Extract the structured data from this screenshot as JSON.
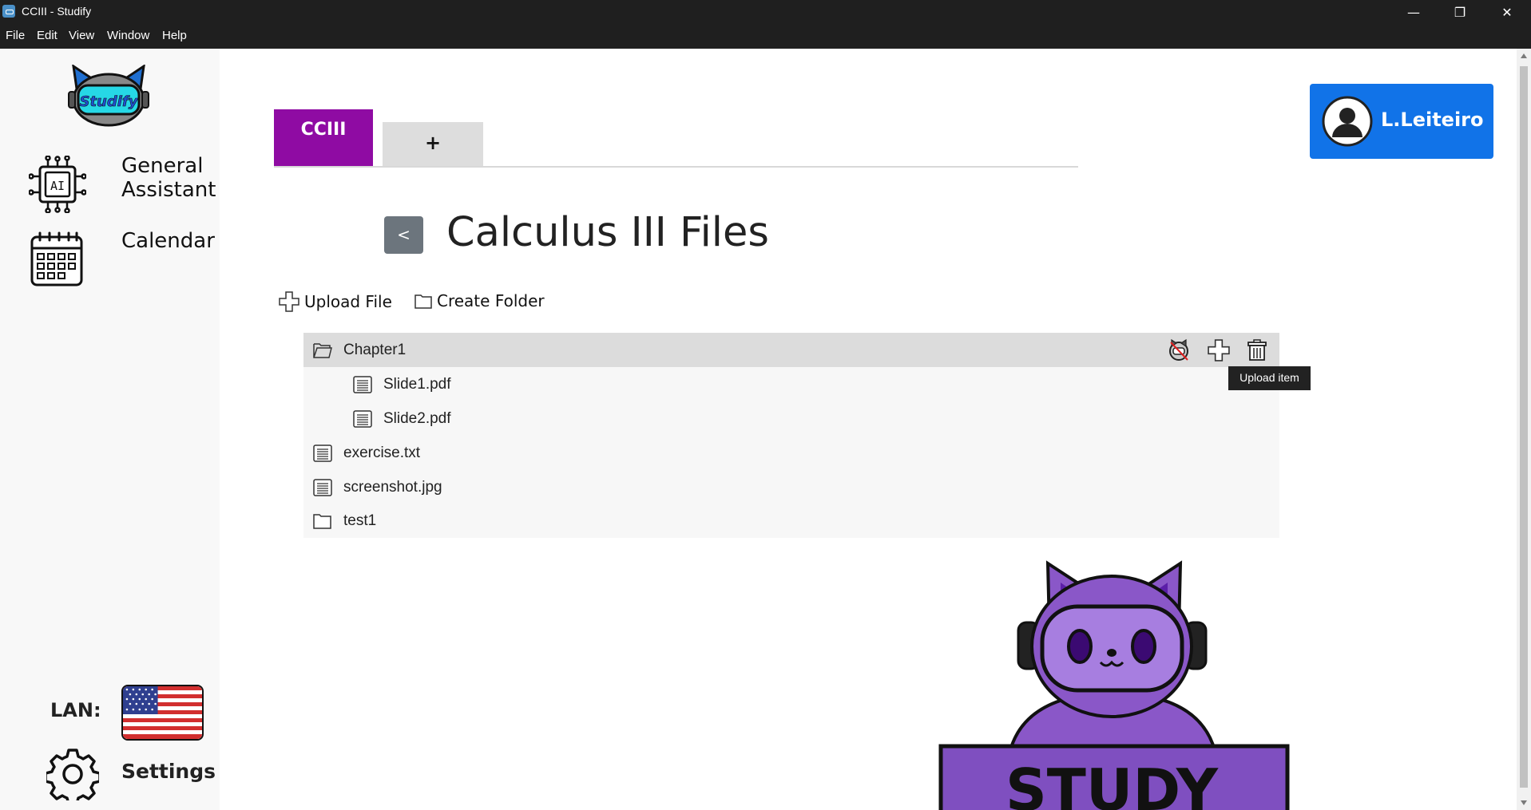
{
  "window": {
    "title": "CCIII - Studify",
    "minimize_glyph": "—",
    "maximize_glyph": "❐",
    "close_glyph": "✕"
  },
  "menubar": {
    "items": [
      "File",
      "Edit",
      "View",
      "Window",
      "Help"
    ]
  },
  "sidebar": {
    "logo_text": "Studify",
    "items": [
      {
        "label": "General Assistant",
        "icon": "ai-chip-icon",
        "icon_text": "AI"
      },
      {
        "label": "Calendar",
        "icon": "calendar-icon"
      }
    ],
    "language_label": "LAN:",
    "language_flag": "us-flag-icon",
    "settings_label": "Settings"
  },
  "tabs": {
    "active_label": "CCIII",
    "add_label": "+"
  },
  "user": {
    "name": "L.Leiteiro",
    "button_color": "#1173e8"
  },
  "main": {
    "back_label": "<",
    "title": "Calculus III Files",
    "actions": {
      "upload_label": "Upload File",
      "create_folder_label": "Create Folder"
    },
    "files": [
      {
        "name": "Chapter1",
        "type": "folder-open",
        "level": 0,
        "selected": true
      },
      {
        "name": "Slide1.pdf",
        "type": "file",
        "level": 1
      },
      {
        "name": "Slide2.pdf",
        "type": "file",
        "level": 1
      },
      {
        "name": "exercise.txt",
        "type": "file",
        "level": 0
      },
      {
        "name": "screenshot.jpg",
        "type": "file",
        "level": 0
      },
      {
        "name": "test1",
        "type": "folder",
        "level": 0
      }
    ],
    "tooltip": "Upload item"
  },
  "mascot": {
    "sign_text": "STUDY"
  },
  "colors": {
    "accent_tab": "#8f0ba3",
    "user_button": "#1173e8",
    "back_button": "#6c757d",
    "mascot": "#8a57c8"
  }
}
